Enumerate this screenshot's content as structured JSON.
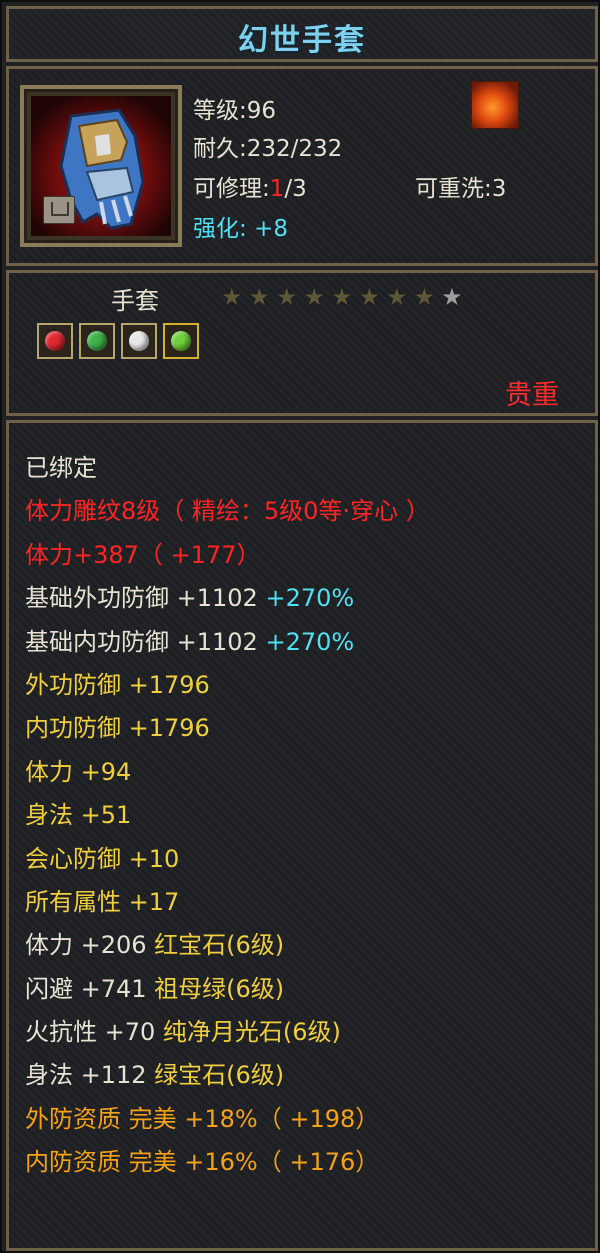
{
  "item": {
    "name": "幻世手套",
    "level_label": "等级:96",
    "durability_label": "耐久:232/232",
    "repair_prefix": "可修理:",
    "repair_current": "1",
    "repair_max": "/3",
    "reroll_label": "可重洗:3",
    "enhance_label": "强化: +8",
    "type": "手套",
    "stars_filled": 8,
    "stars_total": 9,
    "rarity": "贵重",
    "icon": "gauntlet-icon",
    "set_icon": "flame-set-icon"
  },
  "gems": [
    {
      "icon": "red-gem-icon",
      "color": "#e02830"
    },
    {
      "icon": "green-gem-icon",
      "color": "#3fb04a"
    },
    {
      "icon": "slash-gem-icon",
      "color": "#e8e8e8"
    },
    {
      "icon": "jade-gem-icon",
      "color": "#6fd03a"
    }
  ],
  "attributes": [
    {
      "text": "已绑定",
      "color": "white"
    },
    {
      "text": "体力雕纹8级（ 精绘：5级0等·穿心 ）",
      "color": "red"
    },
    {
      "text": "体力+387（ +177）",
      "color": "red"
    },
    {
      "text": "基础外功防御 +1102",
      "extra": " +270%",
      "color": "white"
    },
    {
      "text": "基础内功防御 +1102",
      "extra": " +270%",
      "color": "white"
    },
    {
      "text": "外功防御 +1796",
      "color": "gold"
    },
    {
      "text": "内功防御 +1796",
      "color": "gold"
    },
    {
      "text": "体力 +94",
      "color": "gold"
    },
    {
      "text": "身法 +51",
      "color": "gold"
    },
    {
      "text": "会心防御 +10",
      "color": "gold"
    },
    {
      "text": "所有属性 +17",
      "color": "gold"
    },
    {
      "text": "体力 +206",
      "extra": " 红宝石(6级)",
      "color": "white",
      "extra_color": "gold"
    },
    {
      "text": "闪避 +741",
      "extra": " 祖母绿(6级)",
      "color": "white",
      "extra_color": "gold"
    },
    {
      "text": "火抗性 +70",
      "extra": " 纯净月光石(6级)",
      "color": "white",
      "extra_color": "gold"
    },
    {
      "text": "身法 +112",
      "extra": " 绿宝石(6级)",
      "color": "white",
      "extra_color": "gold"
    },
    {
      "text": "外防资质  完美 +18%（ +198）",
      "color": "orange"
    },
    {
      "text": "内防资质  完美 +16%（ +176）",
      "color": "orange"
    }
  ]
}
